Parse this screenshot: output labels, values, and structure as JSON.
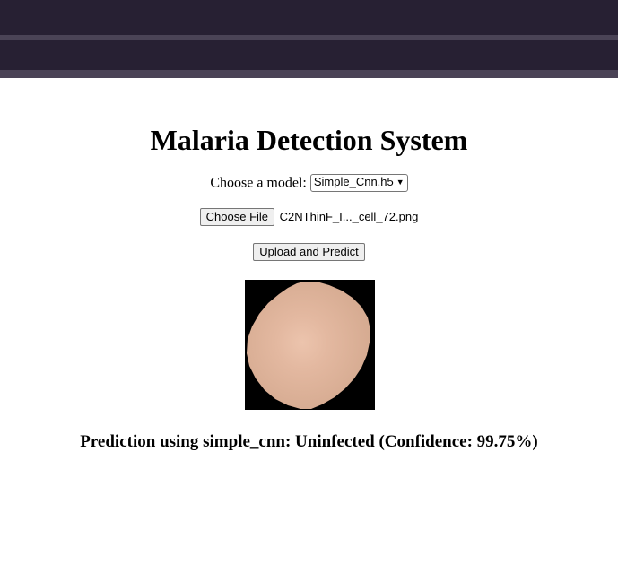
{
  "page": {
    "title": "Malaria Detection System"
  },
  "model_picker": {
    "label": "Choose a model:",
    "selected": "Simple_Cnn.h5"
  },
  "file_picker": {
    "button_label": "Choose File",
    "file_name": "C2NThinF_I..._cell_72.png"
  },
  "upload": {
    "button_label": "Upload and Predict"
  },
  "result": {
    "text": "Prediction using simple_cnn: Uninfected (Confidence: 99.75%)"
  },
  "colors": {
    "header_bg": "#272033",
    "header_stripe": "#4a4356",
    "cell_color": "#dcb6a0",
    "image_bg": "#000000"
  }
}
